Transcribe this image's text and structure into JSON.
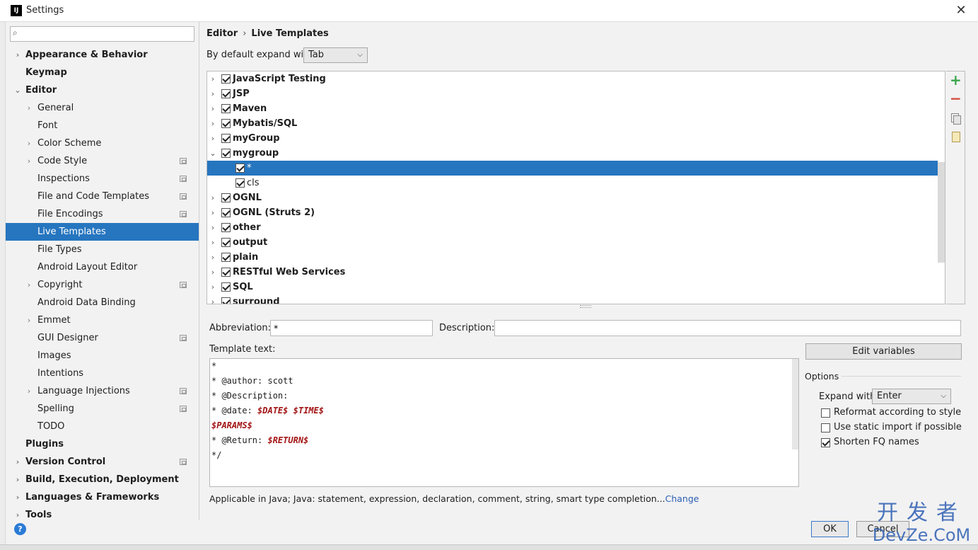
{
  "window": {
    "title": "Settings",
    "logo_text": "IJ",
    "close_glyph": "✕"
  },
  "search": {
    "placeholder": "",
    "icon": "search-icon"
  },
  "sidebar": {
    "items": [
      {
        "label": "Appearance & Behavior",
        "level": 0,
        "bold": true,
        "arrow": "›",
        "project": false,
        "selected": false
      },
      {
        "label": "Keymap",
        "level": 0,
        "bold": true,
        "arrow": "",
        "project": false,
        "selected": false
      },
      {
        "label": "Editor",
        "level": 0,
        "bold": true,
        "arrow": "⌄",
        "project": false,
        "selected": false
      },
      {
        "label": "General",
        "level": 1,
        "bold": false,
        "arrow": "›",
        "project": false,
        "selected": false
      },
      {
        "label": "Font",
        "level": 1,
        "bold": false,
        "arrow": "",
        "project": false,
        "selected": false
      },
      {
        "label": "Color Scheme",
        "level": 1,
        "bold": false,
        "arrow": "›",
        "project": false,
        "selected": false
      },
      {
        "label": "Code Style",
        "level": 1,
        "bold": false,
        "arrow": "›",
        "project": true,
        "selected": false
      },
      {
        "label": "Inspections",
        "level": 1,
        "bold": false,
        "arrow": "",
        "project": true,
        "selected": false
      },
      {
        "label": "File and Code Templates",
        "level": 1,
        "bold": false,
        "arrow": "",
        "project": true,
        "selected": false
      },
      {
        "label": "File Encodings",
        "level": 1,
        "bold": false,
        "arrow": "",
        "project": true,
        "selected": false
      },
      {
        "label": "Live Templates",
        "level": 1,
        "bold": false,
        "arrow": "",
        "project": false,
        "selected": true
      },
      {
        "label": "File Types",
        "level": 1,
        "bold": false,
        "arrow": "",
        "project": false,
        "selected": false
      },
      {
        "label": "Android Layout Editor",
        "level": 1,
        "bold": false,
        "arrow": "",
        "project": false,
        "selected": false
      },
      {
        "label": "Copyright",
        "level": 1,
        "bold": false,
        "arrow": "›",
        "project": true,
        "selected": false
      },
      {
        "label": "Android Data Binding",
        "level": 1,
        "bold": false,
        "arrow": "",
        "project": false,
        "selected": false
      },
      {
        "label": "Emmet",
        "level": 1,
        "bold": false,
        "arrow": "›",
        "project": false,
        "selected": false
      },
      {
        "label": "GUI Designer",
        "level": 1,
        "bold": false,
        "arrow": "",
        "project": true,
        "selected": false
      },
      {
        "label": "Images",
        "level": 1,
        "bold": false,
        "arrow": "",
        "project": false,
        "selected": false
      },
      {
        "label": "Intentions",
        "level": 1,
        "bold": false,
        "arrow": "",
        "project": false,
        "selected": false
      },
      {
        "label": "Language Injections",
        "level": 1,
        "bold": false,
        "arrow": "›",
        "project": true,
        "selected": false
      },
      {
        "label": "Spelling",
        "level": 1,
        "bold": false,
        "arrow": "",
        "project": true,
        "selected": false
      },
      {
        "label": "TODO",
        "level": 1,
        "bold": false,
        "arrow": "",
        "project": false,
        "selected": false
      },
      {
        "label": "Plugins",
        "level": 0,
        "bold": true,
        "arrow": "",
        "project": false,
        "selected": false
      },
      {
        "label": "Version Control",
        "level": 0,
        "bold": true,
        "arrow": "›",
        "project": true,
        "selected": false
      },
      {
        "label": "Build, Execution, Deployment",
        "level": 0,
        "bold": true,
        "arrow": "›",
        "project": false,
        "selected": false
      },
      {
        "label": "Languages & Frameworks",
        "level": 0,
        "bold": true,
        "arrow": "›",
        "project": false,
        "selected": false
      },
      {
        "label": "Tools",
        "level": 0,
        "bold": true,
        "arrow": "›",
        "project": false,
        "selected": false
      }
    ]
  },
  "help": {
    "glyph": "?"
  },
  "breadcrumb": {
    "parent": "Editor",
    "separator": "›",
    "current": "Live Templates"
  },
  "expand_default": {
    "label": "By default expand with",
    "value": "Tab"
  },
  "templates": [
    {
      "name": "JavaScript Testing",
      "group": true,
      "expanded": false,
      "checked": true,
      "selected": false
    },
    {
      "name": "JSP",
      "group": true,
      "expanded": false,
      "checked": true,
      "selected": false
    },
    {
      "name": "Maven",
      "group": true,
      "expanded": false,
      "checked": true,
      "selected": false
    },
    {
      "name": "Mybatis/SQL",
      "group": true,
      "expanded": false,
      "checked": true,
      "selected": false
    },
    {
      "name": "myGroup",
      "group": true,
      "expanded": false,
      "checked": true,
      "selected": false
    },
    {
      "name": "mygroup",
      "group": true,
      "expanded": true,
      "checked": true,
      "selected": false
    },
    {
      "name": "*",
      "group": false,
      "expanded": false,
      "checked": true,
      "selected": true
    },
    {
      "name": "cls",
      "group": false,
      "expanded": false,
      "checked": true,
      "selected": false
    },
    {
      "name": "OGNL",
      "group": true,
      "expanded": false,
      "checked": true,
      "selected": false
    },
    {
      "name": "OGNL (Struts 2)",
      "group": true,
      "expanded": false,
      "checked": true,
      "selected": false
    },
    {
      "name": "other",
      "group": true,
      "expanded": false,
      "checked": true,
      "selected": false
    },
    {
      "name": "output",
      "group": true,
      "expanded": false,
      "checked": true,
      "selected": false
    },
    {
      "name": "plain",
      "group": true,
      "expanded": false,
      "checked": true,
      "selected": false
    },
    {
      "name": "RESTful Web Services",
      "group": true,
      "expanded": false,
      "checked": true,
      "selected": false
    },
    {
      "name": "SQL",
      "group": true,
      "expanded": false,
      "checked": true,
      "selected": false
    },
    {
      "name": "surround",
      "group": true,
      "expanded": false,
      "checked": true,
      "selected": false
    }
  ],
  "toolbar": {
    "add": "+",
    "remove": "−"
  },
  "form": {
    "abbreviation_label": "Abbreviation:",
    "abbreviation_value": "*",
    "description_label": "Description:",
    "description_value": "",
    "template_text_label": "Template text:"
  },
  "template_code": [
    [
      {
        "t": "*",
        "v": false
      }
    ],
    [
      {
        "t": "* @author: scott",
        "v": false
      }
    ],
    [
      {
        "t": "* @Description:",
        "v": false
      }
    ],
    [
      {
        "t": "* @date: ",
        "v": false
      },
      {
        "t": "$DATE$",
        "v": true
      },
      {
        "t": " ",
        "v": false
      },
      {
        "t": "$TIME$",
        "v": true
      }
    ],
    [
      {
        "t": "$PARAMS$",
        "v": true
      }
    ],
    [
      {
        "t": "* @Return: ",
        "v": false
      },
      {
        "t": "$RETURN$",
        "v": true
      }
    ],
    [
      {
        "t": "*/",
        "v": false
      }
    ]
  ],
  "edit_variables_label": "Edit variables",
  "options": {
    "title": "Options",
    "expand_label": "Expand with",
    "expand_value": "Enter",
    "reformat": {
      "label": "Reformat according to style",
      "checked": false
    },
    "static_import": {
      "label": "Use static import if possible",
      "checked": false
    },
    "shorten_fq": {
      "label": "Shorten FQ names",
      "checked": true
    }
  },
  "applicable": {
    "text": "Applicable in Java; Java: statement, expression, declaration, comment, string, smart type completion...",
    "link": "Change"
  },
  "buttons": {
    "ok": "OK",
    "cancel": "Cancel"
  },
  "watermark": {
    "top": "开发者",
    "bottom": "DevZe.CoM"
  },
  "colors": {
    "selection": "#2675bf",
    "accent_blue": "#2b5fb4",
    "template_variable": "#a31515"
  }
}
